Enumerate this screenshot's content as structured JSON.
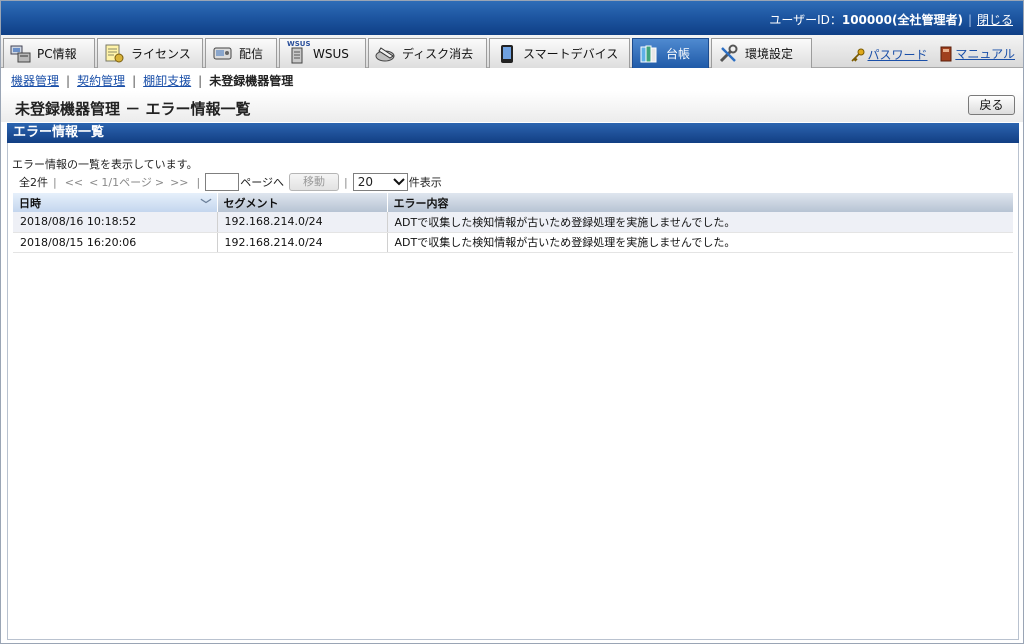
{
  "header": {
    "user_label": "ユーザーID：",
    "user_value": "100000(全社管理者)",
    "close_link": "閉じる"
  },
  "tabs": [
    {
      "label": "PC情報",
      "icon": "pc-icon"
    },
    {
      "label": "ライセンス",
      "icon": "license-icon"
    },
    {
      "label": "配信",
      "icon": "delivery-icon"
    },
    {
      "label": "WSUS",
      "icon": "wsus-icon",
      "tag": "WSUS"
    },
    {
      "label": "ディスク消去",
      "icon": "disk-erase-icon"
    },
    {
      "label": "スマートデバイス",
      "icon": "smart-device-icon"
    },
    {
      "label": "台帳",
      "icon": "ledger-icon",
      "active": true
    },
    {
      "label": "環境設定",
      "icon": "settings-icon"
    }
  ],
  "right_links": {
    "password": "パスワード",
    "manual": "マニュアル"
  },
  "breadcrumb": {
    "items": [
      "機器管理",
      "契約管理",
      "棚卸支援"
    ],
    "current": "未登録機器管理"
  },
  "page": {
    "title": "未登録機器管理 － エラー情報一覧",
    "back_button": "戻る",
    "section_title": "エラー情報一覧",
    "description": "エラー情報の一覧を表示しています。"
  },
  "pager": {
    "total": "全2件",
    "first": "<<",
    "prev": "<",
    "page_info": "1/1ページ",
    "next": ">",
    "last": ">>",
    "page_input_value": "",
    "page_suffix": "ページへ",
    "move_button": "移動",
    "page_size": "20",
    "page_size_suffix": "件表示"
  },
  "table": {
    "columns": [
      "日時",
      "セグメント",
      "エラー内容"
    ],
    "rows": [
      [
        "2018/08/16 10:18:52",
        "192.168.214.0/24",
        "ADTで収集した検知情報が古いため登録処理を実施しませんでした。"
      ],
      [
        "2018/08/15 16:20:06",
        "192.168.214.0/24",
        "ADTで収集した検知情報が古いため登録処理を実施しませんでした。"
      ]
    ]
  },
  "colors": {
    "header_blue": "#1e57a2",
    "link_blue": "#1a4fa8",
    "active_tab": "#2f6fbd"
  }
}
